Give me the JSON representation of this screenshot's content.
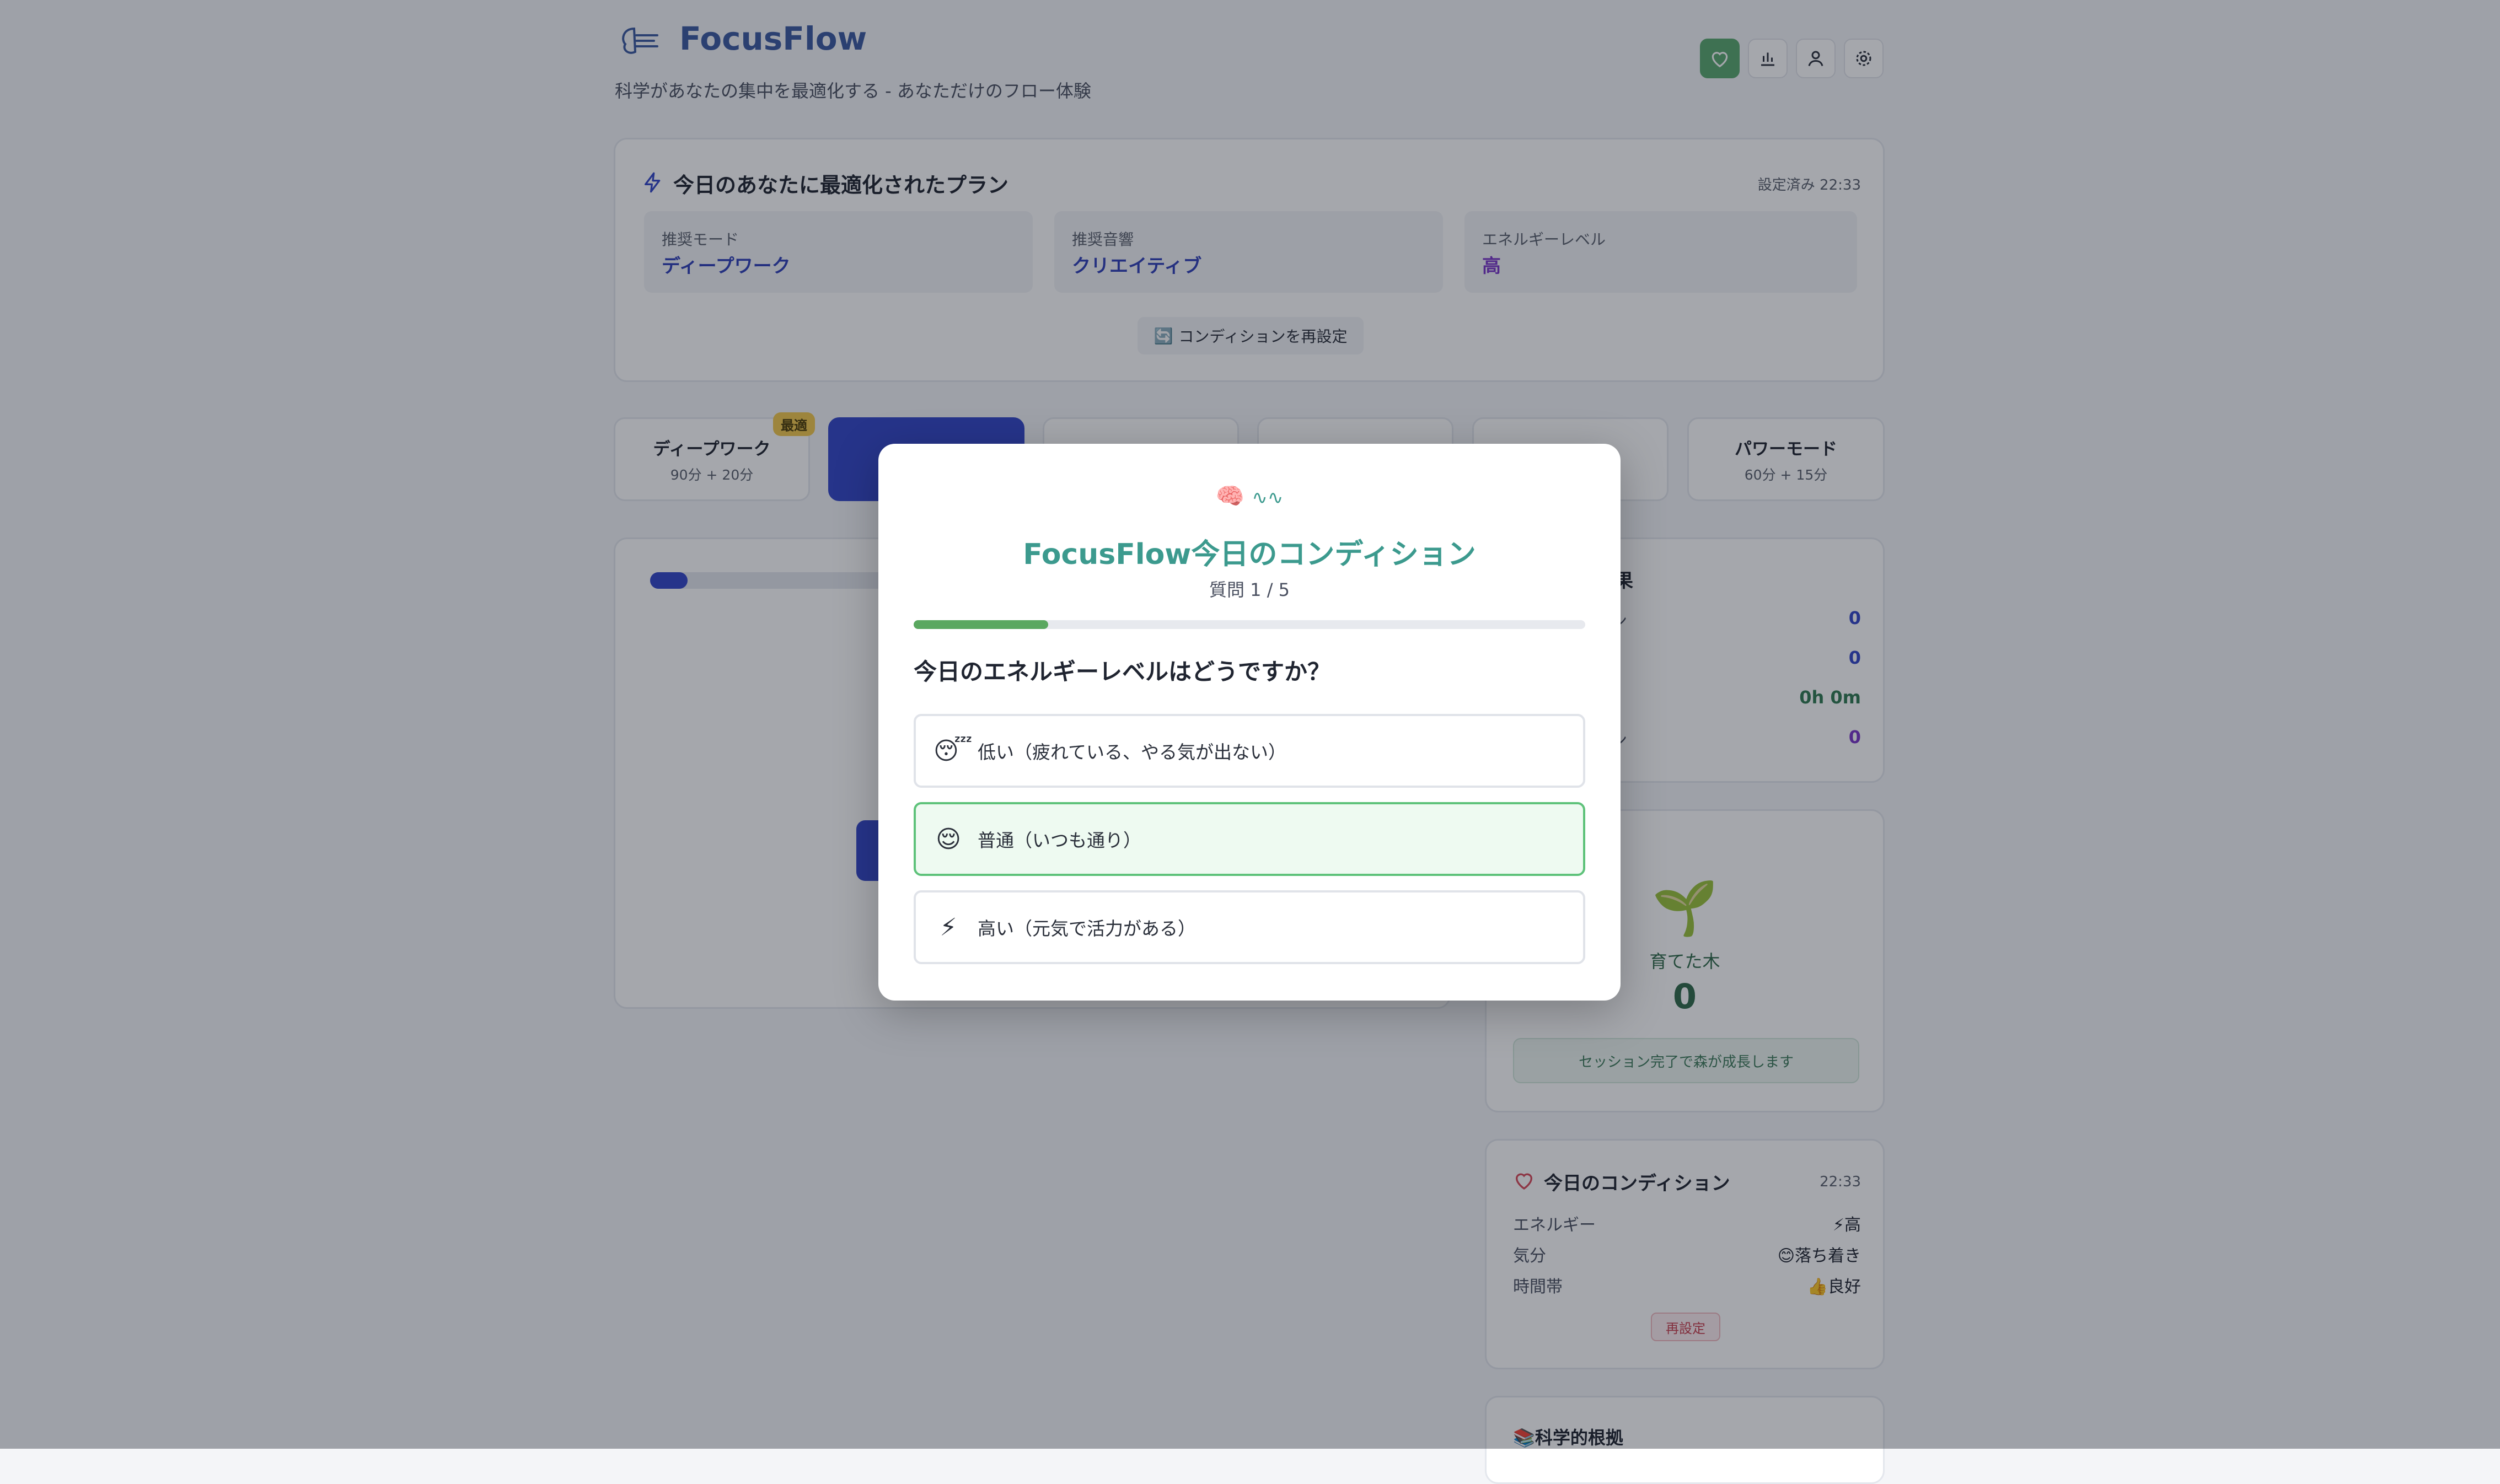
{
  "header": {
    "app_name": "FocusFlow",
    "tagline": "科学があなたの集中を最適化する - あなただけのフロー体験",
    "toolbar": [
      "condition",
      "stats",
      "profile",
      "settings"
    ]
  },
  "plan": {
    "title": "今日のあなたに最適化されたプラン",
    "status": "設定済み 22:33",
    "items": [
      {
        "label": "推奨モード",
        "value": "ディープワーク"
      },
      {
        "label": "推奨音響",
        "value": "クリエイティブ"
      },
      {
        "label": "エネルギーレベル",
        "value": "高"
      }
    ],
    "reset_label": "コンディションを再設定",
    "reset_icon": "🔄"
  },
  "modes": [
    {
      "title": "ディープワーク",
      "sub": "90分 + 20分",
      "badge": "最適"
    },
    {
      "title": "",
      "sub": ""
    },
    {
      "title": "",
      "sub": ""
    },
    {
      "title": "",
      "sub": ""
    },
    {
      "title": "",
      "sub": ""
    },
    {
      "title": "パワーモード",
      "sub": "60分 + 15分"
    }
  ],
  "stats_card": {
    "title_fragment": "果",
    "rows": [
      {
        "label": "ン",
        "value": "0"
      },
      {
        "label": "",
        "value": "0"
      },
      {
        "label": "",
        "value": "0h 0m"
      },
      {
        "label": "ン",
        "value": "0"
      }
    ]
  },
  "forest": {
    "icon": "🌱",
    "label": "育てた木",
    "count": "0",
    "note": "セッション完了で森が成長します"
  },
  "condition": {
    "title": "今日のコンディション",
    "time": "22:33",
    "rows": [
      {
        "label": "エネルギー",
        "emoji": "⚡",
        "value": "高"
      },
      {
        "label": "気分",
        "emoji": "😊",
        "value": "落ち着き"
      },
      {
        "label": "時間帯",
        "emoji": "👍",
        "value": "良好"
      }
    ],
    "reset": "再設定"
  },
  "science": {
    "icon": "📚",
    "title": "科学的根拠"
  },
  "modal": {
    "icon_brain": "🧠",
    "icon_wave": "∿∿",
    "title": "FocusFlow今日のコンディション",
    "step": "質問 1 / 5",
    "progress": 0.2,
    "question": "今日のエネルギーレベルはどうですか？",
    "options": [
      {
        "emoji": "😴",
        "label": "低い（疲れている、やる気が出ない）",
        "selected": false
      },
      {
        "emoji": "😌",
        "label": "普通（いつも通り）",
        "selected": true
      },
      {
        "emoji": "⚡",
        "label": "高い（元気で活力がある）",
        "selected": false
      }
    ]
  },
  "colors": {
    "accent": "#3346c9",
    "modal_title": "#3c9a8e",
    "progress": "#5aa860",
    "selected_border": "#5ec27a"
  }
}
